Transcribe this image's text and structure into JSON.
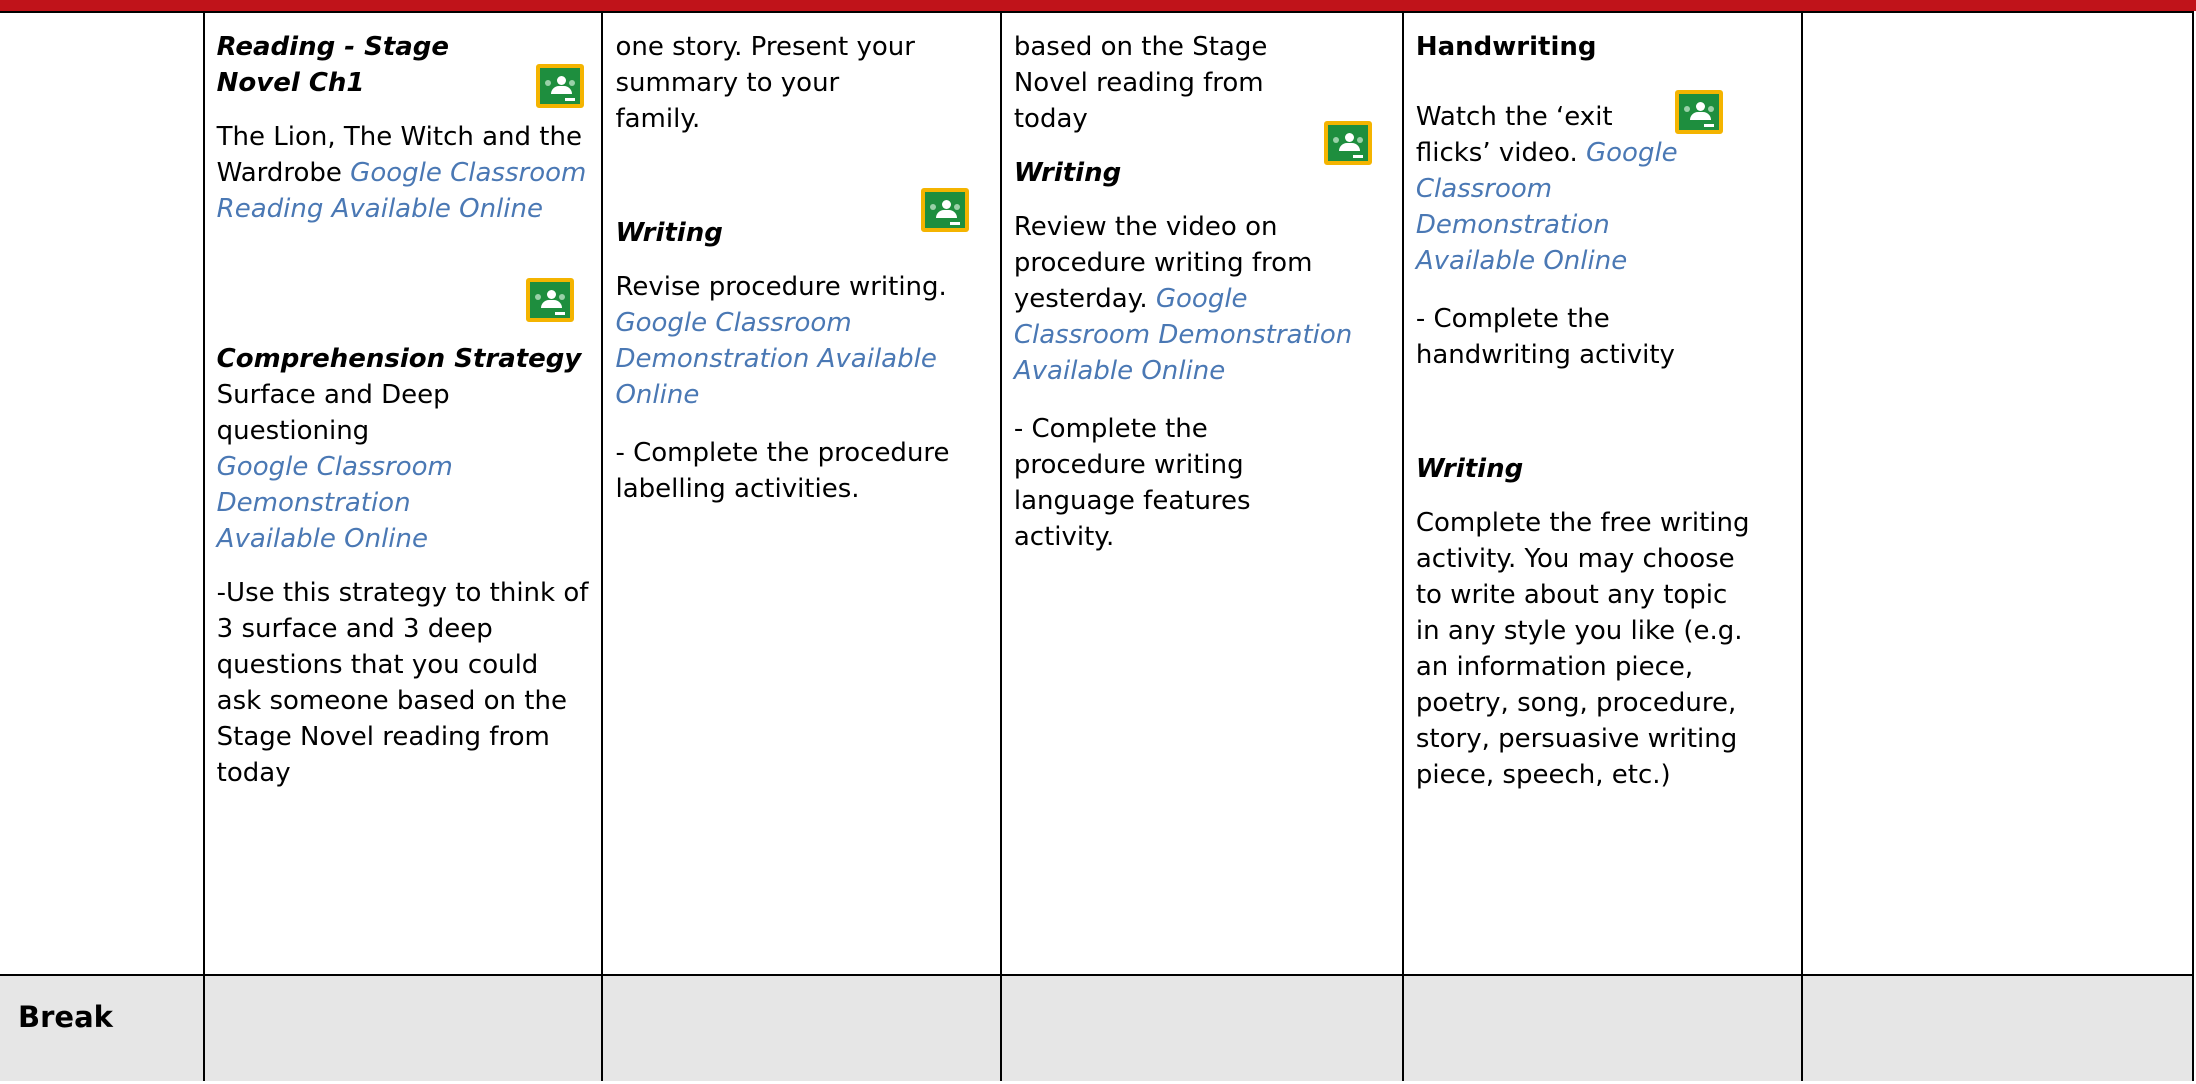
{
  "colors": {
    "top_bar": "#c0131a",
    "link": "#4a78b4",
    "break_row_bg": "#e6e6e6",
    "icon_green": "#1e8e3e",
    "icon_border": "#f4b400"
  },
  "icons": {
    "classroom": "google-classroom-icon"
  },
  "col1": {
    "reading_title": "Reading - Stage Novel Ch1",
    "reading_text": "The Lion, The Witch and the Wardrobe ",
    "reading_link": "Google Classroom Reading Available Online",
    "comp_title": "Comprehension Strategy",
    "comp_text": "Surface and Deep questioning",
    "comp_link": "Google Classroom Demonstration Available Online",
    "comp_task": "-Use this strategy to think of 3 surface and 3 deep questions that you could ask someone based on the Stage Novel reading from today"
  },
  "col2": {
    "intro": "one story. Present your summary to your family.",
    "writing_title": "Writing",
    "writing_text": "Revise procedure writing. ",
    "writing_link": "Google Classroom Demonstration Available Online",
    "task": "- Complete the procedure labelling activities."
  },
  "col3": {
    "intro": "based on the Stage Novel reading from today",
    "writing_title": "Writing",
    "writing_text": "Review the video on procedure writing from yesterday. ",
    "writing_link": "Google Classroom Demonstration Available Online",
    "task": "- Complete the procedure writing language features activity."
  },
  "col4": {
    "hw_title": "Handwriting",
    "hw_text": "Watch the ‘exit flicks’ video. ",
    "hw_link": "Google Classroom Demonstration Available Online",
    "hw_task": "- Complete the handwriting activity",
    "writing_title": "Writing",
    "writing_text": "Complete the free writing activity. You may choose to write about any topic in any style you like (e.g. an information piece, poetry, song, procedure, story, persuasive writing piece, speech, etc.)"
  },
  "break_row": {
    "label": "Break"
  }
}
